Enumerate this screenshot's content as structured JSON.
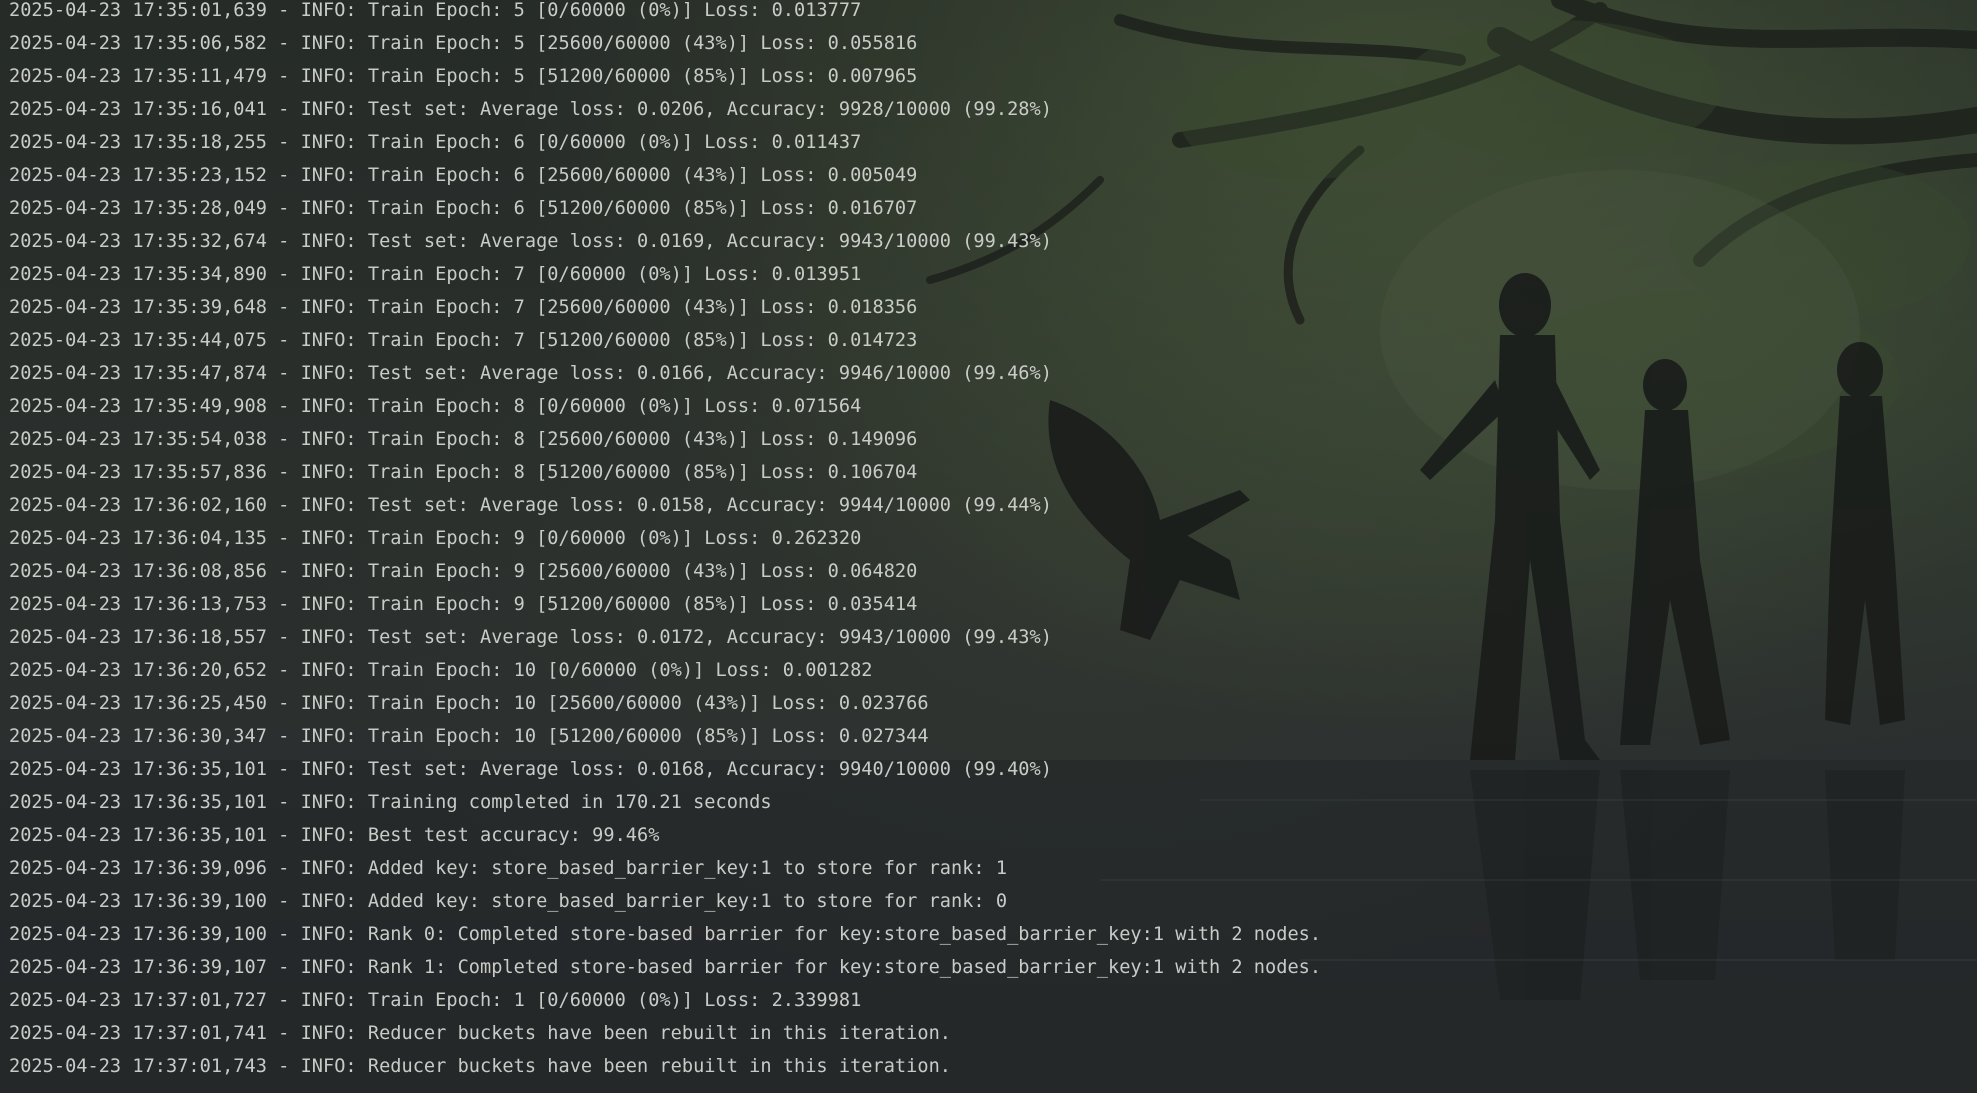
{
  "console": {
    "background": "forest-scene-wallpaper",
    "text_color": "#c9cbc7",
    "lines": [
      "2025-04-23 17:35:01,639 - INFO: Train Epoch: 5 [0/60000 (0%)] Loss: 0.013777",
      "2025-04-23 17:35:06,582 - INFO: Train Epoch: 5 [25600/60000 (43%)] Loss: 0.055816",
      "2025-04-23 17:35:11,479 - INFO: Train Epoch: 5 [51200/60000 (85%)] Loss: 0.007965",
      "2025-04-23 17:35:16,041 - INFO: Test set: Average loss: 0.0206, Accuracy: 9928/10000 (99.28%)",
      "2025-04-23 17:35:18,255 - INFO: Train Epoch: 6 [0/60000 (0%)] Loss: 0.011437",
      "2025-04-23 17:35:23,152 - INFO: Train Epoch: 6 [25600/60000 (43%)] Loss: 0.005049",
      "2025-04-23 17:35:28,049 - INFO: Train Epoch: 6 [51200/60000 (85%)] Loss: 0.016707",
      "2025-04-23 17:35:32,674 - INFO: Test set: Average loss: 0.0169, Accuracy: 9943/10000 (99.43%)",
      "2025-04-23 17:35:34,890 - INFO: Train Epoch: 7 [0/60000 (0%)] Loss: 0.013951",
      "2025-04-23 17:35:39,648 - INFO: Train Epoch: 7 [25600/60000 (43%)] Loss: 0.018356",
      "2025-04-23 17:35:44,075 - INFO: Train Epoch: 7 [51200/60000 (85%)] Loss: 0.014723",
      "2025-04-23 17:35:47,874 - INFO: Test set: Average loss: 0.0166, Accuracy: 9946/10000 (99.46%)",
      "2025-04-23 17:35:49,908 - INFO: Train Epoch: 8 [0/60000 (0%)] Loss: 0.071564",
      "2025-04-23 17:35:54,038 - INFO: Train Epoch: 8 [25600/60000 (43%)] Loss: 0.149096",
      "2025-04-23 17:35:57,836 - INFO: Train Epoch: 8 [51200/60000 (85%)] Loss: 0.106704",
      "2025-04-23 17:36:02,160 - INFO: Test set: Average loss: 0.0158, Accuracy: 9944/10000 (99.44%)",
      "2025-04-23 17:36:04,135 - INFO: Train Epoch: 9 [0/60000 (0%)] Loss: 0.262320",
      "2025-04-23 17:36:08,856 - INFO: Train Epoch: 9 [25600/60000 (43%)] Loss: 0.064820",
      "2025-04-23 17:36:13,753 - INFO: Train Epoch: 9 [51200/60000 (85%)] Loss: 0.035414",
      "2025-04-23 17:36:18,557 - INFO: Test set: Average loss: 0.0172, Accuracy: 9943/10000 (99.43%)",
      "2025-04-23 17:36:20,652 - INFO: Train Epoch: 10 [0/60000 (0%)] Loss: 0.001282",
      "2025-04-23 17:36:25,450 - INFO: Train Epoch: 10 [25600/60000 (43%)] Loss: 0.023766",
      "2025-04-23 17:36:30,347 - INFO: Train Epoch: 10 [51200/60000 (85%)] Loss: 0.027344",
      "2025-04-23 17:36:35,101 - INFO: Test set: Average loss: 0.0168, Accuracy: 9940/10000 (99.40%)",
      "2025-04-23 17:36:35,101 - INFO: Training completed in 170.21 seconds",
      "2025-04-23 17:36:35,101 - INFO: Best test accuracy: 99.46%",
      "2025-04-23 17:36:39,096 - INFO: Added key: store_based_barrier_key:1 to store for rank: 1",
      "2025-04-23 17:36:39,100 - INFO: Added key: store_based_barrier_key:1 to store for rank: 0",
      "2025-04-23 17:36:39,100 - INFO: Rank 0: Completed store-based barrier for key:store_based_barrier_key:1 with 2 nodes.",
      "2025-04-23 17:36:39,107 - INFO: Rank 1: Completed store-based barrier for key:store_based_barrier_key:1 with 2 nodes.",
      "2025-04-23 17:37:01,727 - INFO: Train Epoch: 1 [0/60000 (0%)] Loss: 2.339981",
      "2025-04-23 17:37:01,741 - INFO: Reducer buckets have been rebuilt in this iteration.",
      "2025-04-23 17:37:01,743 - INFO: Reducer buckets have been rebuilt in this iteration."
    ]
  }
}
